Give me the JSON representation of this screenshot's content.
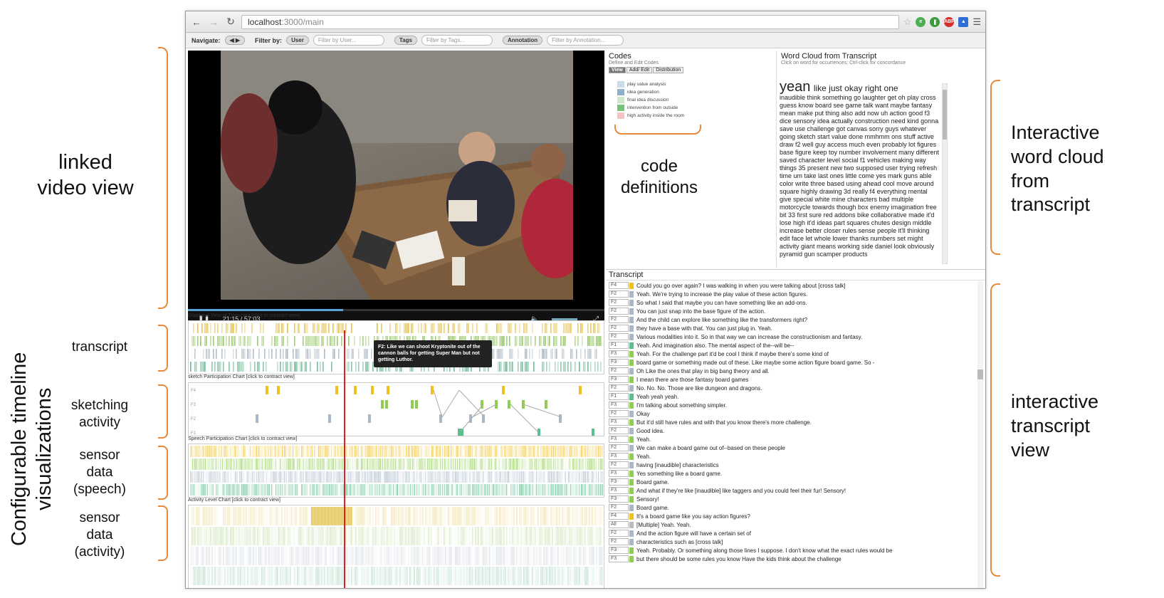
{
  "annotations": {
    "linked_video": "linked\nvideo view",
    "transcript": "transcript",
    "sketching": "sketching\nactivity",
    "sensor_speech": "sensor\ndata\n(speech)",
    "sensor_activity": "sensor\ndata\n(activity)",
    "configurable": "Configurable timeline\nvisualizations",
    "code_definitions": "code\ndefinitions",
    "word_cloud": "Interactive\nword cloud\nfrom\ntranscript",
    "interactive_transcript": "interactive\ntranscript\nview"
  },
  "browser": {
    "url": "localhost:3000/main",
    "url_host": "localhost",
    "url_path": ":3000/main"
  },
  "toolbar": {
    "navigate_label": "Navigate:",
    "filter_label": "Filter by:",
    "user_pill": "User",
    "user_placeholder": "Filter by User...",
    "tags_pill": "Tags",
    "tags_placeholder": "Filter by Tags...",
    "annotation_pill": "Annotation",
    "annotation_placeholder": "Filter by Annotation..."
  },
  "video": {
    "time": "21:15",
    "separator": "/",
    "duration": "57:03",
    "progress": 0.373
  },
  "codes": {
    "title": "Codes",
    "subtitle": "Define and Edit Codes",
    "tabs": [
      "View",
      "Add/ Edit",
      "Distribution"
    ],
    "items": [
      {
        "label": "play value analysis",
        "color": "#c9dde8"
      },
      {
        "label": "idea generation",
        "color": "#8fb0c8"
      },
      {
        "label": "final idea discussion",
        "color": "#cfe7c8"
      },
      {
        "label": "intervention from outside",
        "color": "#7cc17a"
      },
      {
        "label": "high activity inside the room",
        "color": "#f5c4c4"
      }
    ]
  },
  "wordcloud": {
    "title": "Word Cloud from Transcript",
    "hint": "Click on word for occurrences; Ctrl-click for concordance",
    "big": "yeah",
    "medium": "like just okay right one",
    "text": "inaudible think something go laughter get oh play cross guess know board see game talk want maybe fantasy mean make put thing also add now uh action good f3 dice sensory idea actually construction need kind gonna save use challenge got canvas sorry guys whatever going sketch start value done mmhmm ons stuff active draw f2 well guy access much even probably lot figures base figure keep toy number involvement many different saved character level social f1 vehicles making way things 35 present new two supposed user trying refresh time um take last ones little come yes mark guns able color write three based using ahead cool move around square highly drawing 3d really f4 everything mental give special white mine characters bad multiple motorcycle towards though box enemy imagination free bit 33 first sure red addons bike collaborative made it'd lose high it'd ideas part squares chutes design middle increase better closer rules sense people it'll thinking edit face let whole lower thanks numbers set might activity giant means working side daniel look obviously pyramid gun scamper products"
  },
  "transcript": {
    "title": "Transcript",
    "rows": [
      {
        "spk": "F4",
        "color": "#f0c020",
        "text": "Could you go over again? I was walking in when you were talking about [cross talk]"
      },
      {
        "spk": "F2",
        "color": "#a8b8c8",
        "text": "Yeah. We're trying to increase the play value of these action figures."
      },
      {
        "spk": "F2",
        "color": "#a8b8c8",
        "text": "So what I said that maybe you can have something like an add-ons."
      },
      {
        "spk": "F2",
        "color": "#a8b8c8",
        "text": "You can just snap into the base figure of the action."
      },
      {
        "spk": "F2",
        "color": "#a8b8c8",
        "text": "And the child can explore like something like the transformers right?"
      },
      {
        "spk": "F2",
        "color": "#a8b8c8",
        "text": "they have a base with that. You can just plug in. Yeah."
      },
      {
        "spk": "F2",
        "color": "#a8b8c8",
        "text": "Various modalities into it. So in that way we can increase the constructionism and fantasy."
      },
      {
        "spk": "F1",
        "color": "#5cbf8f",
        "text": "Yeah. And imagination also. The mental aspect of the--will be--"
      },
      {
        "spk": "F3",
        "color": "#8fcf50",
        "text": "Yeah. For the challenge part it'd be cool I think if maybe there's some kind of"
      },
      {
        "spk": "F3",
        "color": "#8fcf50",
        "text": "board game or something made out of these. Like maybe some action figure board game. So -"
      },
      {
        "spk": "F2",
        "color": "#a8b8c8",
        "text": "Oh Like the ones that play in big bang theory and all."
      },
      {
        "spk": "F3",
        "color": "#8fcf50",
        "text": "I mean there are those fantasy board games"
      },
      {
        "spk": "F2",
        "color": "#a8b8c8",
        "text": "No. No. No. Those are like dungeon and dragons."
      },
      {
        "spk": "F1",
        "color": "#5cbf8f",
        "text": "Yeah yeah yeah."
      },
      {
        "spk": "F3",
        "color": "#8fcf50",
        "text": "I'm talking about something simpler."
      },
      {
        "spk": "F2",
        "color": "#a8b8c8",
        "text": "Okay"
      },
      {
        "spk": "F3",
        "color": "#8fcf50",
        "text": "But it'd still have rules and with that you know there's more challenge."
      },
      {
        "spk": "F2",
        "color": "#a8b8c8",
        "text": "Good idea."
      },
      {
        "spk": "F3",
        "color": "#8fcf50",
        "text": "Yeah."
      },
      {
        "spk": "F2",
        "color": "#a8b8c8",
        "text": "We can make a board game out of--based on these people"
      },
      {
        "spk": "F3",
        "color": "#8fcf50",
        "text": "Yeah."
      },
      {
        "spk": "F2",
        "color": "#a8b8c8",
        "text": "having [inaudible] characteristics"
      },
      {
        "spk": "F3",
        "color": "#8fcf50",
        "text": "Yes something like a board game."
      },
      {
        "spk": "F3",
        "color": "#8fcf50",
        "text": "Board game."
      },
      {
        "spk": "F3",
        "color": "#8fcf50",
        "text": "And what if they're like [inaudible] like taggers and you could feel their fur! Sensory!"
      },
      {
        "spk": "F3",
        "color": "#8fcf50",
        "text": "Sensory!"
      },
      {
        "spk": "F2",
        "color": "#a8b8c8",
        "text": "Board game."
      },
      {
        "spk": "F4",
        "color": "#f0c020",
        "text": "It's a board game like you say action figures?"
      },
      {
        "spk": "All",
        "color": "#bbbbbb",
        "text": "[Multiple] Yeah. Yeah."
      },
      {
        "spk": "F2",
        "color": "#a8b8c8",
        "text": "And the action figure will have a certain set of"
      },
      {
        "spk": "F2",
        "color": "#a8b8c8",
        "text": "characteristics such as [cross talk]"
      },
      {
        "spk": "F3",
        "color": "#8fcf50",
        "text": "Yeah. Probably. Or something along those lines I suppose. I don't know what the exact rules would be"
      },
      {
        "spk": "F3",
        "color": "#8fcf50",
        "text": "but there should be some rules you know Have the kids think about the challenge"
      }
    ]
  },
  "charts": {
    "graphical_transcript": "Graphical View of Transcript [click to contract view]",
    "sketch": "sketch Participation Chart [click to contract view]",
    "speech": "Speech Participation Chart [click to contract view]",
    "activity": "Activity Level Chart [click to contract view]",
    "tooltip": "F2: Like we can shoot Kryptonite out of the cannon balls for getting Super Man but not getting Luthor.",
    "sketch_rows": [
      "F4",
      "F3",
      "F2",
      "F1"
    ]
  }
}
